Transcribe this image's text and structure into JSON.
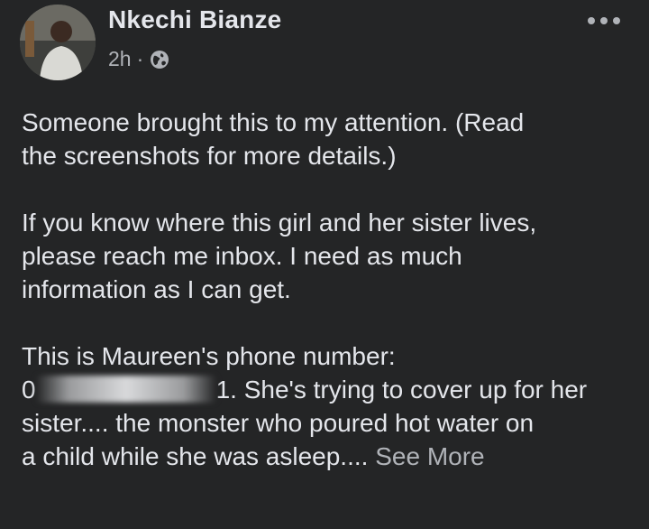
{
  "post": {
    "author": "Nkechi Bianze",
    "time": "2h",
    "separator": "·",
    "privacy_icon": "globe-icon",
    "more_icon": "more-options-icon",
    "paragraphs": {
      "p1_line1": "Someone brought this to my attention. (Read",
      "p1_line2": "the screenshots for more details.)",
      "p2_line1": "If you know where this girl and her sister lives,",
      "p2_line2": "please reach me inbox. I need as much",
      "p2_line3": "information as I can get.",
      "p3_line1": "This is Maureen's phone number:",
      "p3_line2_prefix": "0",
      "p3_line2_suffix": "1. She's trying to cover up for her",
      "p3_line3": "sister.... the monster who poured hot water on",
      "p3_line4": "a child while she was asleep.... "
    },
    "see_more": "See More"
  },
  "colors": {
    "background": "#242526",
    "primary_text": "#e4e6eb",
    "secondary_text": "#b0b3b8"
  }
}
